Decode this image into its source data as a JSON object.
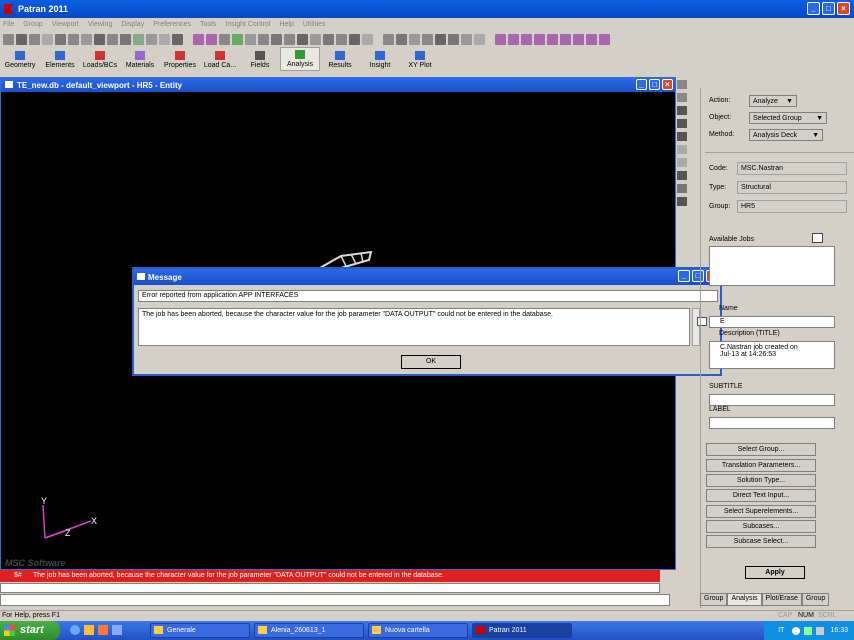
{
  "app": {
    "title": "Patran 2011"
  },
  "menu": [
    "File",
    "Group",
    "Viewport",
    "Viewing",
    "Display",
    "Preferences",
    "Tools",
    "Insight Control",
    "Help",
    "Utilities"
  ],
  "appbar": [
    {
      "label": "Geometry",
      "icon": "geometry-icon"
    },
    {
      "label": "Elements",
      "icon": "elements-icon"
    },
    {
      "label": "Loads/BCs",
      "icon": "loads-icon"
    },
    {
      "label": "Materials",
      "icon": "materials-icon"
    },
    {
      "label": "Properties",
      "icon": "properties-icon"
    },
    {
      "label": "Load Ca...",
      "icon": "load-cases-icon"
    },
    {
      "label": "Fields",
      "icon": "fields-icon"
    },
    {
      "label": "Analysis",
      "icon": "analysis-icon"
    },
    {
      "label": "Results",
      "icon": "results-icon"
    },
    {
      "label": "Insight",
      "icon": "insight-icon"
    },
    {
      "label": "XY Plot",
      "icon": "xy-plot-icon"
    }
  ],
  "viewport": {
    "title": "TE_new.db - default_viewport - HR5 - Entity",
    "axis_y": "Y",
    "axis_z": "Z",
    "axis_x": "X",
    "watermark": "MSC Software"
  },
  "message": {
    "title": "Message",
    "source": "Error reported from application APP INTERFACES",
    "text": "The job has been aborted, because the character value for the job parameter \"DATA OUTPUT\" could not be entered in the database.",
    "ok": "OK"
  },
  "panel": {
    "action_label": "Action:",
    "action_value": "Analyze",
    "object_label": "Object:",
    "object_value": "Selected Group",
    "method_label": "Method:",
    "method_value": "Analysis Deck",
    "code_label": "Code:",
    "code_value": "MSC.Nastran",
    "type_label": "Type:",
    "type_value": "Structural",
    "group_label": "Group:",
    "group_value": "HR5",
    "available_jobs": "Available Jobs",
    "name_label": "Name",
    "job_name_value": "E",
    "description_label": "Description (TITLE)",
    "description_value_1": "C.Nastran job created on",
    "description_value_2": "Jul-13 at 14:26:53",
    "subtitle_label": "SUBTITLE",
    "label_label": "LABEL",
    "buttons": [
      "Select Group...",
      "Translation Parameters...",
      "Solution Type...",
      "Direct Text Input...",
      "Select Superelements...",
      "Subcases...",
      "Subcase Select..."
    ],
    "apply": "Apply",
    "tabs": [
      "Group",
      "Analysis",
      "Plot/Erase",
      "Group"
    ]
  },
  "status": {
    "code": "$#",
    "text": "The job has been aborted, because the character value for the job parameter \"DATA OUTPUT\" could not be entered in the database.",
    "help": "For Help, press F1",
    "indicators": [
      "CAP",
      "NUM",
      "SCRL"
    ]
  },
  "taskbar": {
    "start": "start",
    "tasks": [
      "Generale",
      "Alenia_260613_1",
      "Nuova cartella",
      "Patran 2011"
    ],
    "lang": "IT",
    "clock": "16:33"
  }
}
